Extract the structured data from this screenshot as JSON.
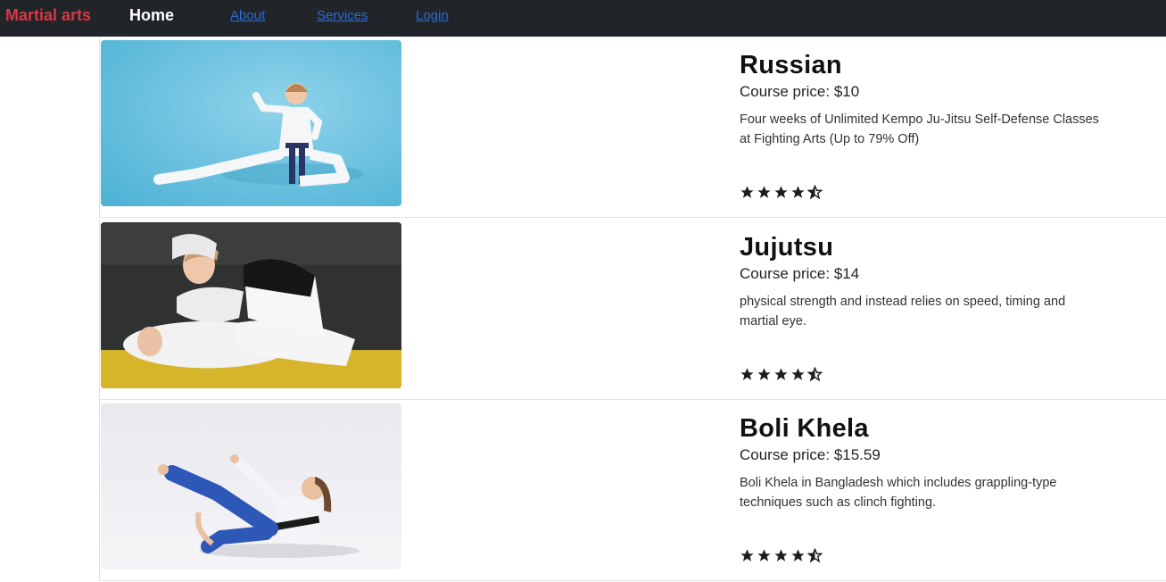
{
  "navbar": {
    "brand": "Martial arts",
    "home": "Home",
    "links": [
      "About",
      "Services",
      "Login"
    ]
  },
  "courses": [
    {
      "title": "Russian",
      "price": "Course price: $10",
      "description": "Four weeks of Unlimited Kempo Ju-Jitsu Self-Defense Classes at Fighting Arts (Up to 79% Off)",
      "rating": 4.5,
      "image_icon": "karate-girl-photo"
    },
    {
      "title": "Jujutsu",
      "price": "Course price: $14",
      "description": "physical strength and instead relies on speed, timing and martial eye.",
      "rating": 4.5,
      "image_icon": "jujutsu-grappling-photo"
    },
    {
      "title": "Boli Khela",
      "price": "Course price: $15.59",
      "description": "Boli Khela in Bangladesh which includes grappling-type techniques such as clinch fighting.",
      "rating": 4.5,
      "image_icon": "kick-woman-photo"
    }
  ],
  "colors": {
    "navbar_bg": "#212529",
    "brand": "#dc3545",
    "link": "#2b6bd6"
  }
}
